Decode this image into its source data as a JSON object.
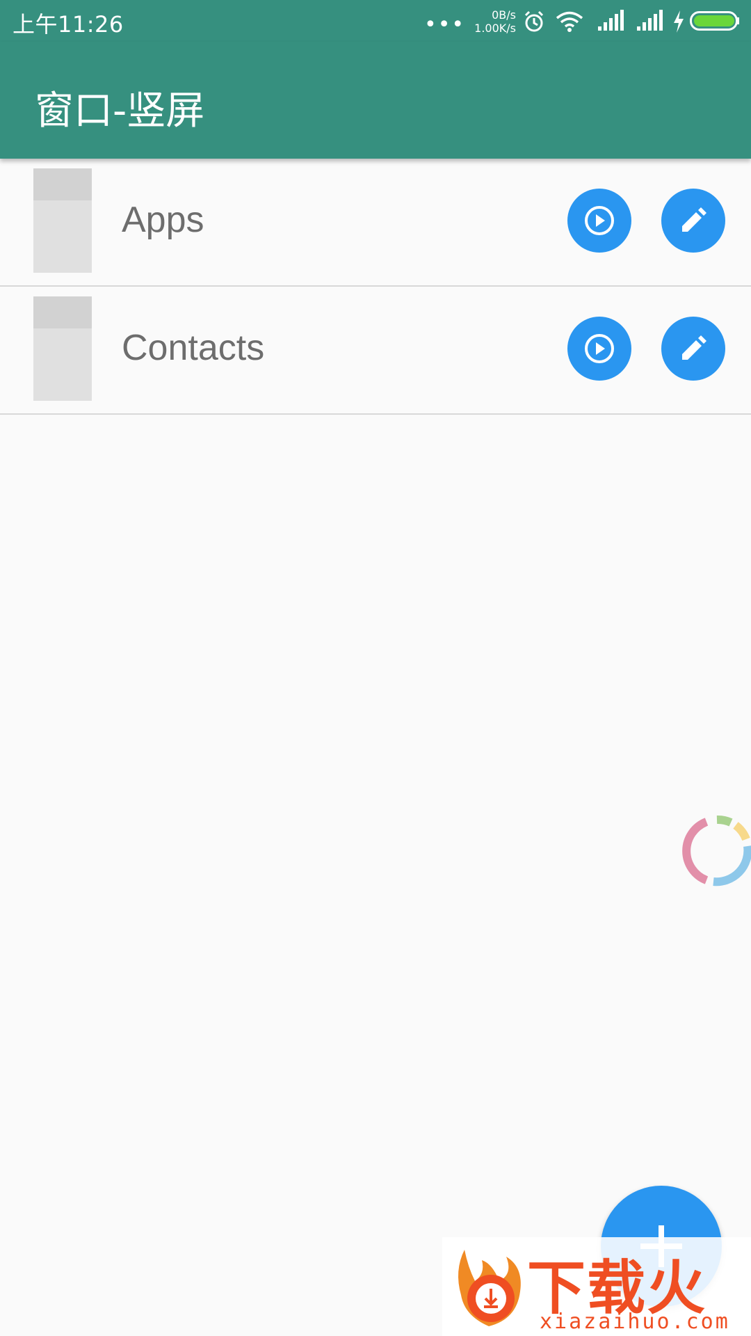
{
  "status_bar": {
    "time": "上午11:26",
    "dots": "•••",
    "net_up": "0B/s",
    "net_down": "1.00K/s",
    "battery_level": 1.0,
    "icons": [
      "alarm-icon",
      "wifi-icon",
      "signal-icon",
      "signal-icon",
      "charging-icon",
      "battery-icon"
    ]
  },
  "app_bar": {
    "title": "窗口-竖屏"
  },
  "list": {
    "items": [
      {
        "label": "Apps"
      },
      {
        "label": "Contacts"
      }
    ]
  },
  "watermark": {
    "title": "下载火",
    "url": "xiazaihuo.com"
  },
  "colors": {
    "primary": "#36907f",
    "accent": "#2a96f0",
    "watermark": "#ef4e22"
  }
}
